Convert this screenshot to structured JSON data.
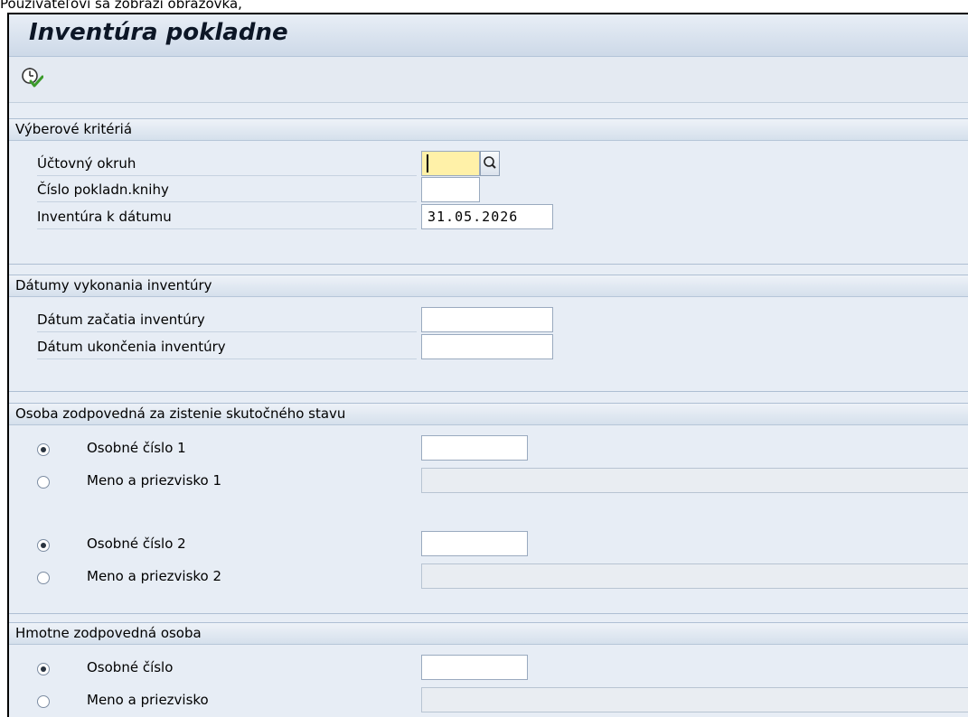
{
  "caption": "Používateľovi sa zobrazí obrazovka,",
  "window": {
    "title": "Inventúra pokladne"
  },
  "toolbar": {
    "execute_icon": "execute-clock-icon"
  },
  "selection": {
    "title": "Výberové kritériá",
    "company_code": {
      "label": "Účtovný okruh",
      "value": ""
    },
    "cash_journal": {
      "label": "Číslo pokladn.knihy",
      "value": ""
    },
    "inventory_date": {
      "label": "Inventúra k dátumu",
      "value": "31.05.2026"
    }
  },
  "dates": {
    "title": "Dátumy vykonania inventúry",
    "start": {
      "label": "Dátum začatia inventúry",
      "value": ""
    },
    "end": {
      "label": "Dátum ukončenia inventúry",
      "value": ""
    }
  },
  "person": {
    "title": "Osoba zodpovedná za zistenie skutočného stavu",
    "pn1": {
      "label": "Osobné číslo 1",
      "value": "",
      "selected": true
    },
    "name1": {
      "label": "Meno a priezvisko 1",
      "value": "",
      "selected": false
    },
    "pn2": {
      "label": "Osobné číslo 2",
      "value": "",
      "selected": true
    },
    "name2": {
      "label": "Meno a priezvisko 2",
      "value": "",
      "selected": false
    }
  },
  "material": {
    "title": "Hmotne zodpovedná osoba",
    "pn": {
      "label": "Osobné číslo",
      "value": "",
      "selected": true
    },
    "name": {
      "label": "Meno a priezvisko",
      "value": "",
      "selected": false
    }
  }
}
